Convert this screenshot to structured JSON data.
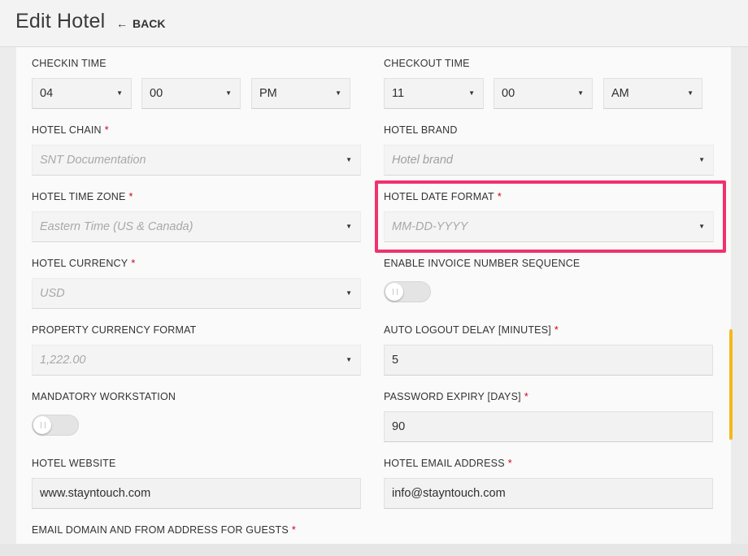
{
  "header": {
    "title": "Edit Hotel",
    "back_label": "BACK"
  },
  "form": {
    "checkin": {
      "label": "CHECKIN TIME",
      "hour": "04",
      "minute": "00",
      "ampm": "PM"
    },
    "checkout": {
      "label": "CHECKOUT TIME",
      "hour": "11",
      "minute": "00",
      "ampm": "AM"
    },
    "hotel_chain": {
      "label": "HOTEL CHAIN",
      "value": "SNT Documentation"
    },
    "hotel_brand": {
      "label": "HOTEL BRAND",
      "placeholder": "Hotel brand"
    },
    "time_zone": {
      "label": "HOTEL TIME ZONE",
      "value": "Eastern Time (US & Canada)"
    },
    "date_format": {
      "label": "HOTEL DATE FORMAT",
      "value": "MM-DD-YYYY"
    },
    "currency": {
      "label": "HOTEL CURRENCY",
      "value": "USD"
    },
    "invoice_seq": {
      "label": "ENABLE INVOICE NUMBER SEQUENCE",
      "enabled": false
    },
    "currency_format": {
      "label": "PROPERTY CURRENCY FORMAT",
      "value": "1,222.00"
    },
    "auto_logout": {
      "label": "AUTO LOGOUT DELAY [MINUTES]",
      "value": "5"
    },
    "mandatory_ws": {
      "label": "MANDATORY WORKSTATION",
      "enabled": false
    },
    "password_expiry": {
      "label": "PASSWORD EXPIRY [DAYS]",
      "value": "90"
    },
    "website": {
      "label": "HOTEL WEBSITE",
      "value": "www.stayntouch.com"
    },
    "email": {
      "label": "HOTEL EMAIL ADDRESS",
      "value": "info@stayntouch.com"
    },
    "email_domain": {
      "label": "EMAIL DOMAIN AND FROM ADDRESS FOR GUESTS"
    },
    "required_mark": "*",
    "dropdown_caret": "▼"
  },
  "colors": {
    "highlight": "#f0326e",
    "required": "#d0021b",
    "scrollbar": "#f5b81c"
  }
}
